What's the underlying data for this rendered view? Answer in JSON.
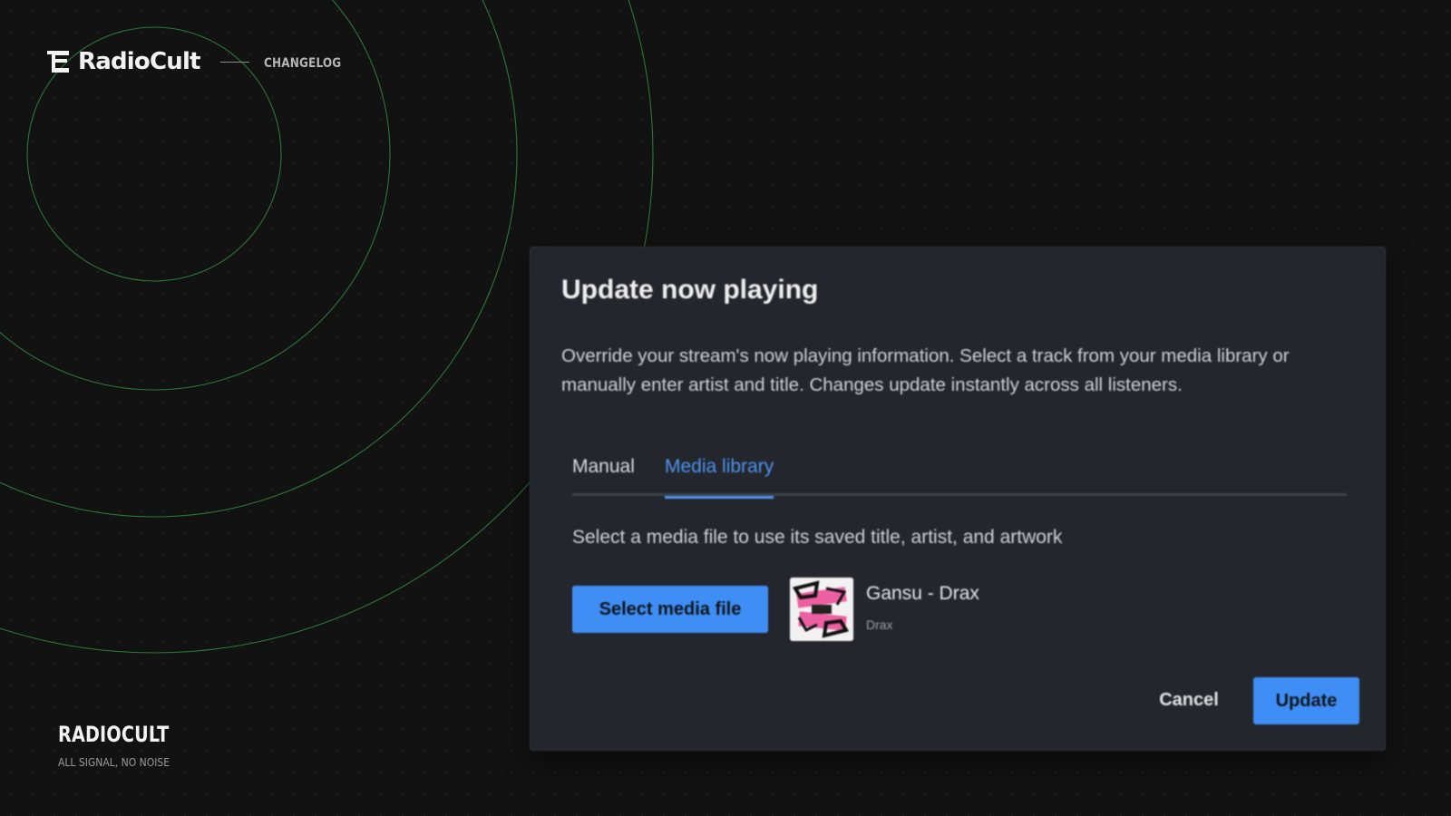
{
  "brand": {
    "logo_text": "RadioCult",
    "link": "CHANGELOG"
  },
  "footer": {
    "name": "RADIOCULT",
    "tagline": "ALL SIGNAL, NO NOISE"
  },
  "dialog": {
    "title": "Update now playing",
    "description": "Override your stream's now playing information. Select a track from your media library or manually enter artist and title. Changes update instantly across all listeners.",
    "tabs": [
      {
        "label": "Manual",
        "active": false
      },
      {
        "label": "Media library",
        "active": true
      }
    ],
    "media_hint": "Select a media file to use its saved title, artist, and artwork",
    "select_button": "Select media file",
    "selected_track": {
      "title": "Gansu - Drax",
      "artist": "Drax",
      "artwork_icon": "album-artwork"
    },
    "cancel_button": "Cancel",
    "update_button": "Update"
  },
  "colors": {
    "background": "#121212",
    "dialog_bg": "#23272d",
    "accent": "#3f8ef5",
    "tab_active": "#4f93f0",
    "ring": "#2f8a3c"
  }
}
